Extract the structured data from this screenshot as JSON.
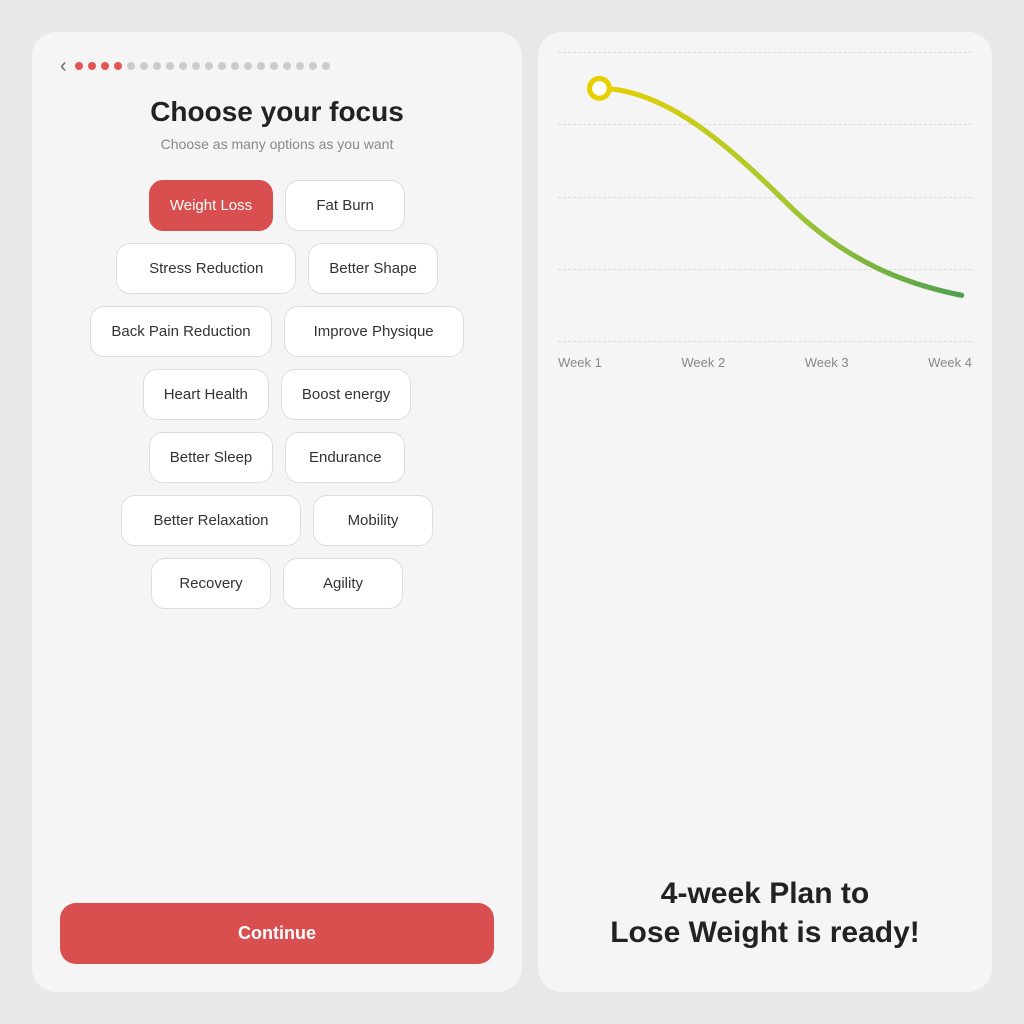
{
  "left": {
    "back_label": "‹",
    "progress_dots": [
      {
        "filled": true
      },
      {
        "filled": true
      },
      {
        "filled": true
      },
      {
        "filled": true
      },
      {
        "filled": false
      },
      {
        "filled": false
      },
      {
        "filled": false
      },
      {
        "filled": false
      },
      {
        "filled": false
      },
      {
        "filled": false
      },
      {
        "filled": false
      },
      {
        "filled": false
      },
      {
        "filled": false
      },
      {
        "filled": false
      },
      {
        "filled": false
      },
      {
        "filled": false
      },
      {
        "filled": false
      },
      {
        "filled": false
      },
      {
        "filled": false
      },
      {
        "filled": false
      }
    ],
    "title": "Choose your focus",
    "subtitle": "Choose as many options as you want",
    "rows": [
      [
        {
          "label": "Weight Loss",
          "selected": true
        },
        {
          "label": "Fat Burn",
          "selected": false
        }
      ],
      [
        {
          "label": "Stress Reduction",
          "selected": false
        },
        {
          "label": "Better Shape",
          "selected": false
        }
      ],
      [
        {
          "label": "Back Pain Reduction",
          "selected": false
        },
        {
          "label": "Improve Physique",
          "selected": false
        }
      ],
      [
        {
          "label": "Heart Health",
          "selected": false
        },
        {
          "label": "Boost energy",
          "selected": false
        }
      ],
      [
        {
          "label": "Better Sleep",
          "selected": false
        },
        {
          "label": "Endurance",
          "selected": false
        }
      ],
      [
        {
          "label": "Better Relaxation",
          "selected": false
        },
        {
          "label": "Mobility",
          "selected": false
        }
      ],
      [
        {
          "label": "Recovery",
          "selected": false
        },
        {
          "label": "Agility",
          "selected": false
        }
      ]
    ],
    "continue_label": "Continue"
  },
  "right": {
    "week_labels": [
      "Week 1",
      "Week 2",
      "Week 3",
      "Week 4"
    ],
    "plan_ready_line1": "4-week Plan to",
    "plan_ready_line2": "Lose Weight is ready!"
  }
}
